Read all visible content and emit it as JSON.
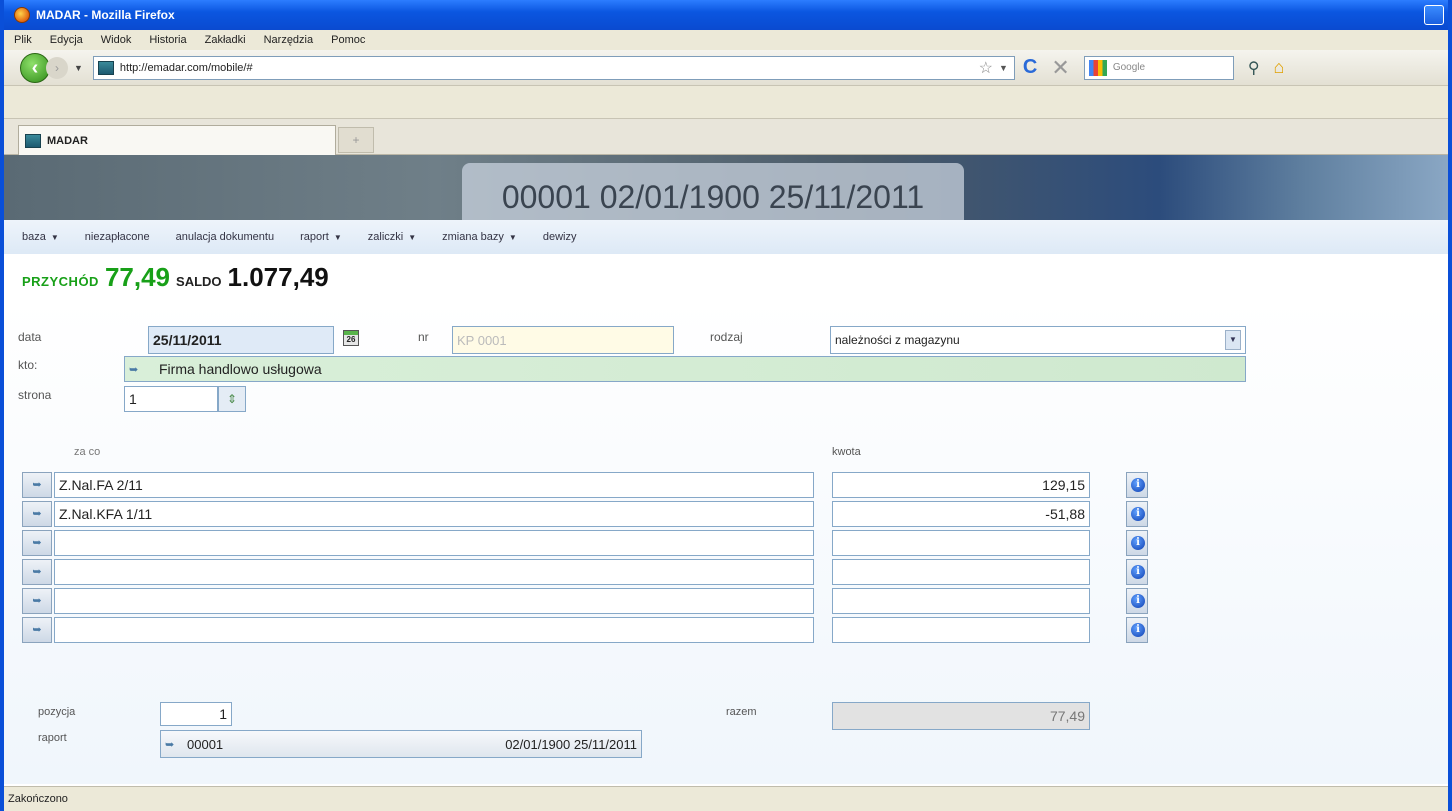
{
  "window": {
    "title": "MADAR - Mozilla Firefox"
  },
  "menubar": [
    "Plik",
    "Edycja",
    "Widok",
    "Historia",
    "Zakładki",
    "Narzędzia",
    "Pomoc"
  ],
  "nav": {
    "url": "http://emadar.com/mobile/#",
    "search_placeholder": "Google"
  },
  "tab": {
    "title": "MADAR",
    "new_tab": "+"
  },
  "banner": {
    "text": "00001 02/01/1900 25/11/2011"
  },
  "appmenu": [
    {
      "label": "baza",
      "has_arrow": true
    },
    {
      "label": "niezapłacone",
      "has_arrow": false
    },
    {
      "label": "anulacja dokumentu",
      "has_arrow": false
    },
    {
      "label": "raport",
      "has_arrow": true
    },
    {
      "label": "zaliczki",
      "has_arrow": true
    },
    {
      "label": "zmiana bazy",
      "has_arrow": true
    },
    {
      "label": "dewizy",
      "has_arrow": false
    }
  ],
  "totals": {
    "przychod_label": "PRZYCHÓD",
    "przychod_value": "77,49",
    "saldo_label": "SALDO",
    "saldo_value": "1.077,49"
  },
  "form": {
    "data_label": "data",
    "data_value": "25/11/2011",
    "calendar_day": "26",
    "nr_label": "nr",
    "nr_placeholder": "KP 0001",
    "rodzaj_label": "rodzaj",
    "rodzaj_value": "należności z magazynu",
    "kto_label": "kto:",
    "kto_value": "Firma handlowo usługowa",
    "strona_label": "strona",
    "strona_value": "1"
  },
  "grid": {
    "col_zaco": "za co",
    "col_kwota": "kwota",
    "rows": [
      {
        "zaco": "Z.Nal.FA   2/11",
        "kwota": "129,15"
      },
      {
        "zaco": "Z.Nal.KFA  1/11",
        "kwota": "-51,88"
      },
      {
        "zaco": "",
        "kwota": ""
      },
      {
        "zaco": "",
        "kwota": ""
      },
      {
        "zaco": "",
        "kwota": ""
      },
      {
        "zaco": "",
        "kwota": ""
      }
    ]
  },
  "footer": {
    "pozycja_label": "pozycja",
    "pozycja_value": "1",
    "razem_label": "razem",
    "razem_value": "77,49",
    "raport_label": "raport",
    "raport_value": "00001",
    "raport_dates": "02/01/1900  25/11/2011"
  },
  "status": {
    "text": "Zakończono"
  },
  "colors": {
    "accent_green": "#18a018",
    "titlebar": "#0a4fd8",
    "kto_bg": "#d4efd4"
  }
}
